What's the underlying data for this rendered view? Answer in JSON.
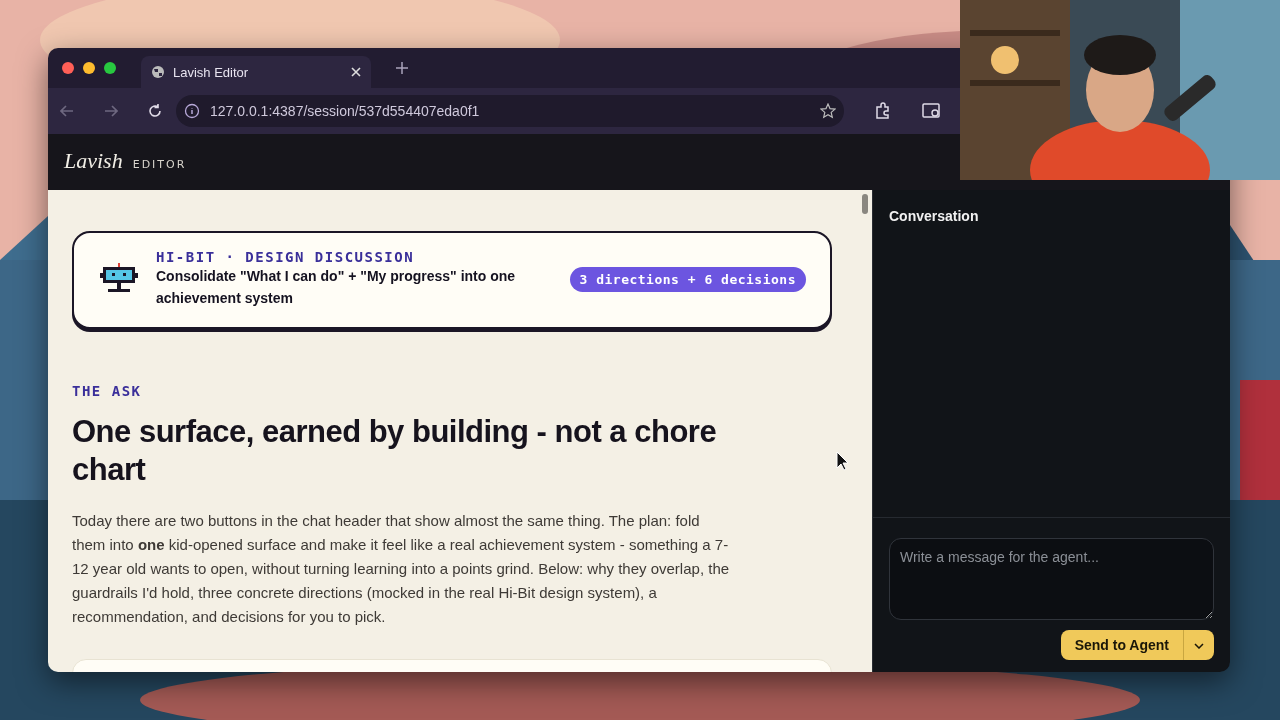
{
  "browser": {
    "tab_title": "Lavish Editor",
    "url": "127.0.0.1:4387/session/537d554407eda0f1"
  },
  "app": {
    "brand": "Lavish",
    "brand_sub": "EDITOR"
  },
  "banner": {
    "eyebrow": "HI-BIT · DESIGN DISCUSSION",
    "title": "Consolidate \"What I can do\" + \"My progress\" into one achievement system",
    "pill": "3 directions + 6 decisions"
  },
  "section": {
    "label": "THE ASK",
    "heading": "One surface, earned by building - not a chore chart",
    "body": "Today there are two buttons in the chat header that show almost the same thing. The plan: fold them into **one** kid-opened surface and make it feel like a real achievement system - something a 7-12 year old wants to open, without turning learning into a points grind. Below: why they overlap, the guardrails I'd hold, three concrete directions (mocked in the real Hi-Bit design system), a recommendation, and decisions for you to pick."
  },
  "conversation": {
    "title": "Conversation",
    "placeholder": "Write a message for the agent...",
    "send": "Send to Agent"
  }
}
